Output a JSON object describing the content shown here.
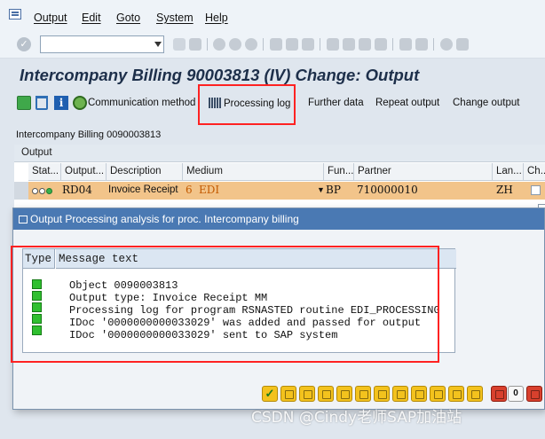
{
  "menu": [
    "Output",
    "Edit",
    "Goto",
    "System",
    "Help"
  ],
  "title": "Intercompany Billing 90003813  (IV) Change: Output",
  "toolbar": {
    "communication_method": "Communication method",
    "processing_log": "Processing log",
    "further_data": "Further data",
    "repeat_output": "Repeat output",
    "change_output": "Change output"
  },
  "doc_line": "Intercompany Billing 0090003813",
  "output": {
    "section_title": "Output",
    "columns": [
      "Stat...",
      "Output...",
      "Description",
      "Medium",
      "Fun...",
      "Partner",
      "Lan...",
      "Ch..."
    ],
    "row": {
      "output_type": "RD04",
      "description": "Invoice Receipt",
      "medium_code": "6",
      "medium": "EDI",
      "function": "BP",
      "partner": "710000010",
      "language": "ZH"
    }
  },
  "dialog": {
    "title": "Output Processing analysis for proc. Intercompany billing",
    "col_type": "Type",
    "col_text": "Message text",
    "messages": [
      "Object 0090003813",
      "Output type: Invoice Receipt MM",
      "Processing log for program RSNASTED routine EDI_PROCESSING",
      "IDoc '0000000000033029' was added and passed for output",
      "IDoc '0000000000033029' sent to SAP system"
    ],
    "error_count": "0"
  },
  "watermark": "CSDN @Cindy老师SAP加油站",
  "colors": {
    "title_bar": "#4a79b3",
    "highlight": "#ff2222",
    "selected_row": "#f2c48a",
    "status_green": "#2fbf2f"
  }
}
